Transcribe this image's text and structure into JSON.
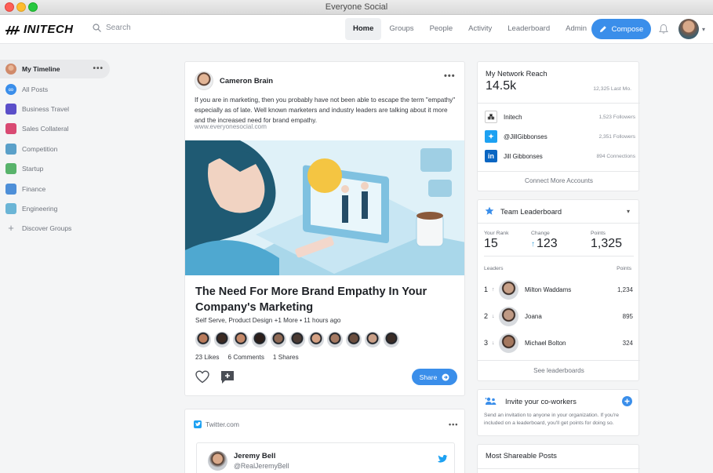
{
  "window": {
    "title": "Everyone Social"
  },
  "brand": {
    "name": "INITECH"
  },
  "search": {
    "placeholder": "Search"
  },
  "nav": {
    "links": [
      "Home",
      "Groups",
      "People",
      "Activity",
      "Leaderboard",
      "Admin"
    ],
    "active": "Home",
    "compose_label": "Compose"
  },
  "sidebar": {
    "items": [
      {
        "label": "My Timeline",
        "icon": "user-avatar-icon",
        "color": "#d08a6a"
      },
      {
        "label": "All Posts",
        "icon": "infinity-icon",
        "color": "#3a8eea"
      },
      {
        "label": "Business Travel",
        "icon": "briefcase-icon",
        "color": "#5b4fc9"
      },
      {
        "label": "Sales Collateral",
        "icon": "star-icon",
        "color": "#d94a73"
      },
      {
        "label": "Competition",
        "icon": "competition-icon",
        "color": "#5aa0c9"
      },
      {
        "label": "Startup",
        "icon": "rocket-icon",
        "color": "#58b36b"
      },
      {
        "label": "Finance",
        "icon": "chart-icon",
        "color": "#4e8fd8"
      },
      {
        "label": "Engineering",
        "icon": "engineering-icon",
        "color": "#6bb5d6"
      },
      {
        "label": "Discover Groups",
        "icon": "plus-icon",
        "color": "#8a8f98"
      }
    ]
  },
  "post": {
    "author": "Cameron Brain",
    "text": "If you are in marketing, then you probably have not been able to escape the term \"empathy\" especially as of late. Well known marketers and industry leaders are talking about it more and the increased need for brand empathy.",
    "url": "www.everyonesocial.com",
    "title": "The Need For More Brand Empathy In Your Company's Marketing",
    "meta": "Self Serve, Product Design +1 More  •  11 hours ago",
    "likes": "23 Likes",
    "comments": "6 Comments",
    "shares": "1 Shares",
    "share_label": "Share",
    "liker_count": 11
  },
  "tweet": {
    "source": "Twitter.com",
    "name": "Jeremy Bell",
    "handle": "@RealJeremyBell"
  },
  "reach": {
    "title": "My Network Reach",
    "value": "14.5k",
    "last_month": "12,325 Last Mo.",
    "accounts": [
      {
        "name": "Initech",
        "count": "1,523 Followers",
        "icon": "initech-logo-icon",
        "color": "#222222"
      },
      {
        "name": "@JillGibbonses",
        "count": "2,351 Followers",
        "icon": "twitter-icon",
        "color": "#1da1f2"
      },
      {
        "name": "Jill Gibbonses",
        "count": "894 Connections",
        "icon": "linkedin-icon",
        "color": "#0a66c2"
      }
    ],
    "connect_label": "Connect More Accounts"
  },
  "leaderboard": {
    "title": "Team Leaderboard",
    "your_rank_label": "Your Rank",
    "your_rank": "15",
    "change_label": "Change",
    "change": "123",
    "points_label": "Points",
    "points": "1,325",
    "leaders_label": "Leaders",
    "points_col_label": "Points",
    "leaders": [
      {
        "rank": "1",
        "trend": "up",
        "name": "Milton Waddams",
        "points": "1,234"
      },
      {
        "rank": "2",
        "trend": "down",
        "name": "Joana",
        "points": "895"
      },
      {
        "rank": "3",
        "trend": "down",
        "name": "Michael Bolton",
        "points": "324"
      }
    ],
    "see_all_label": "See leaderboards"
  },
  "invite": {
    "title": "Invite your co-workers",
    "text": "Send an invitation to anyone in your organization. If you're included on a leaderboard, you'll get points for doing so."
  },
  "shareable": {
    "title": "Most Shareable Posts"
  },
  "colors": {
    "accent": "#3a8eea",
    "background": "#f4f5f6"
  }
}
